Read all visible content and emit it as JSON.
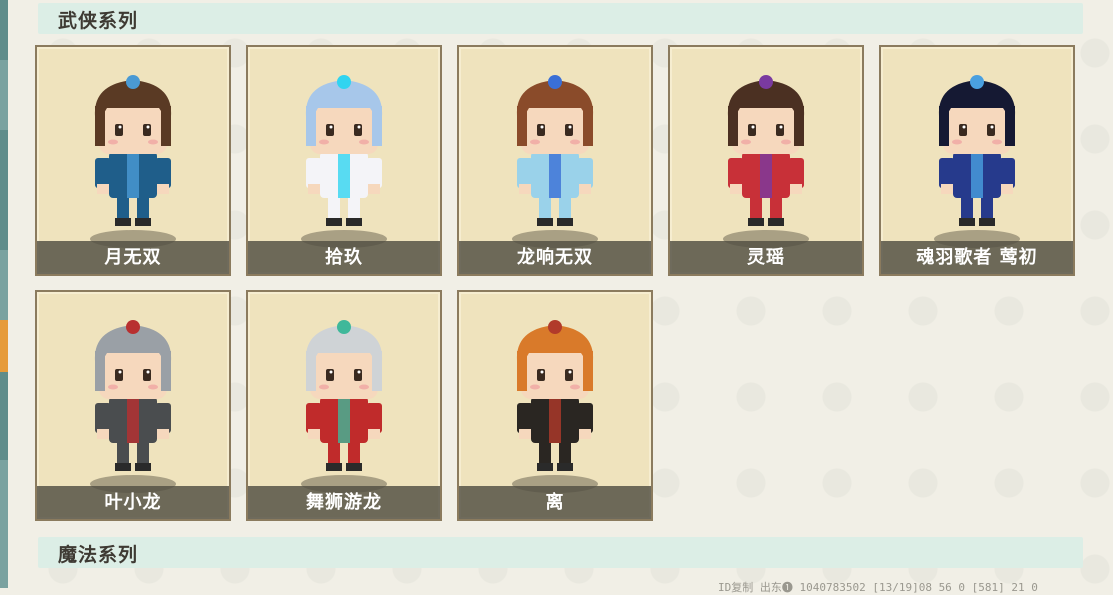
{
  "sections": [
    {
      "title": "武侠系列"
    },
    {
      "title": "魔法系列"
    }
  ],
  "skins": [
    {
      "name": "月无双",
      "colors": {
        "hair": "#5a3a24",
        "outfit": "#1f5e8a",
        "accent": "#4a9ad4"
      }
    },
    {
      "name": "拾玖",
      "colors": {
        "hair": "#a7c7ea",
        "outfit": "#f4f4f8",
        "accent": "#31d4f0"
      }
    },
    {
      "name": "龙响无双",
      "colors": {
        "hair": "#8a4b2a",
        "outfit": "#9ad2ea",
        "accent": "#3a6fd6"
      }
    },
    {
      "name": "灵瑶",
      "colors": {
        "hair": "#4b3022",
        "outfit": "#c83038",
        "accent": "#7a3aa0"
      }
    },
    {
      "name": "魂羽歌者 莺初",
      "colors": {
        "hair": "#151933",
        "outfit": "#263a8c",
        "accent": "#4aa0e0"
      }
    },
    {
      "name": "叶小龙",
      "colors": {
        "hair": "#9aa0a6",
        "outfit": "#4a4d4f",
        "accent": "#b83030"
      }
    },
    {
      "name": "舞狮游龙",
      "colors": {
        "hair": "#cfd3d6",
        "outfit": "#c02b2b",
        "accent": "#3fb89a"
      }
    },
    {
      "name": "离",
      "colors": {
        "hair": "#d97a2a",
        "outfit": "#2a2622",
        "accent": "#b13a2a"
      }
    }
  ],
  "footer": {
    "text": "ID复制  出东❶    1040783502   [13/19]08 56 0  [581] 21 0"
  }
}
